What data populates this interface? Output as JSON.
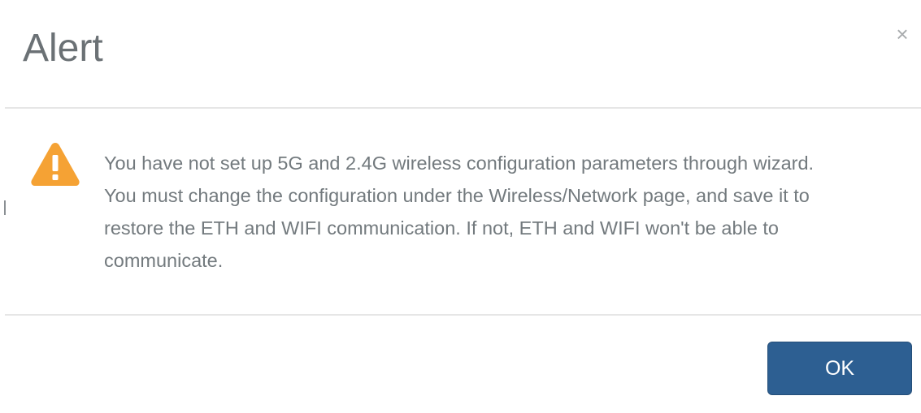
{
  "dialog": {
    "title": "Alert",
    "close_glyph": "×",
    "icon": "warning-triangle-icon",
    "message": "You have not set up 5G and 2.4G wireless configuration parameters through wizard. You must change the configuration under the Wireless/Network page, and save it to restore the ETH and WIFI communication. If not, ETH and WIFI won't be able to communicate.",
    "ok_label": "OK"
  },
  "colors": {
    "warning": "#f5a234",
    "button_primary": "#2d5f92",
    "text": "#737a7e",
    "divider": "#e6e6e6"
  }
}
